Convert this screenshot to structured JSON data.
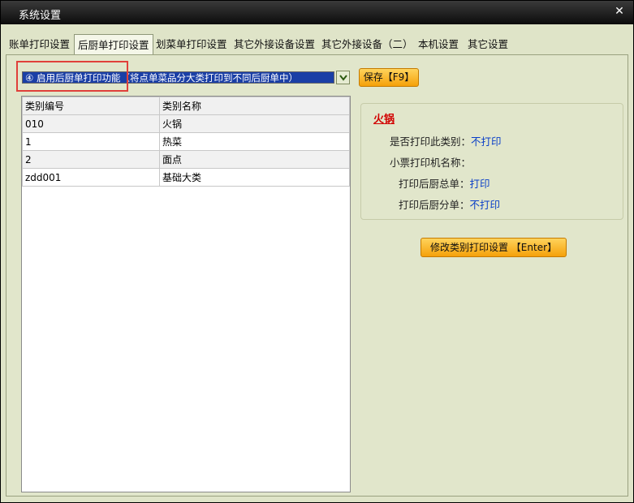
{
  "window": {
    "title": "系统设置"
  },
  "tabs": [
    {
      "label": "账单打印设置"
    },
    {
      "label": "后厨单打印设置",
      "active": true
    },
    {
      "label": "划菜单打印设置"
    },
    {
      "label": "其它外接设备设置"
    },
    {
      "label": "其它外接设备（二）"
    },
    {
      "label": "本机设置"
    },
    {
      "label": "其它设置"
    }
  ],
  "select": {
    "value": "④ 启用后厨单打印功能（将点单菜品分大类打印到不同后厨单中）"
  },
  "buttons": {
    "save": "保存【F9】",
    "edit": "修改类别打印设置 【Enter】"
  },
  "table": {
    "headers": [
      "类别编号",
      "类别名称"
    ],
    "rows": [
      [
        "010",
        "火锅"
      ],
      [
        "1",
        "热菜"
      ],
      [
        "2",
        "面点"
      ],
      [
        "zdd001",
        "基础大类"
      ]
    ]
  },
  "detail": {
    "title": "火锅",
    "print_category_label": "是否打印此类别：",
    "print_category_value": "不打印",
    "printer_name_label": "小票打印机名称：",
    "printer_name_value": "",
    "print_total_label": "打印后厨总单：",
    "print_total_value": "打印",
    "print_split_label": "打印后厨分单：",
    "print_split_value": "不打印"
  },
  "colors": {
    "highlight_box": "#e0403a",
    "value_text": "#0a3fc8",
    "title_red": "#d10000"
  }
}
